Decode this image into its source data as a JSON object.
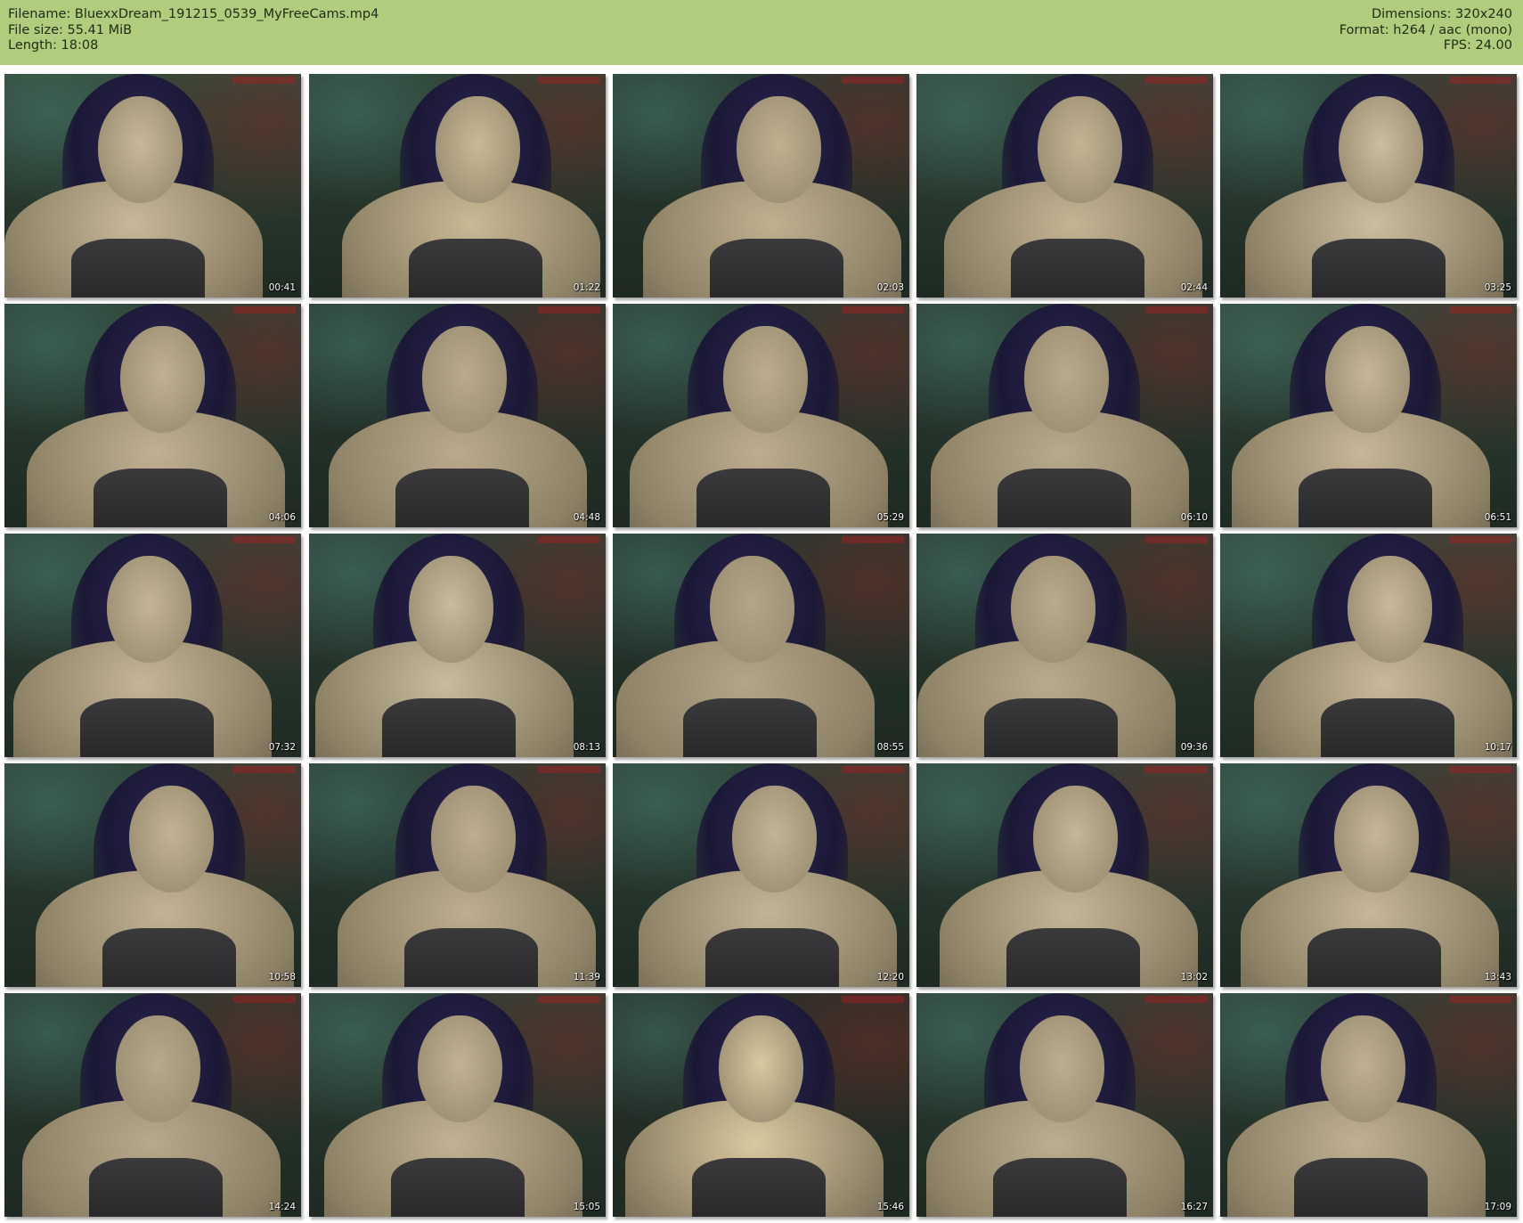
{
  "header": {
    "filename_line": "Filename: BluexxDream_191215_0539_MyFreeCams.mp4",
    "filesize_line": "File size: 55.41 MiB",
    "length_line": "Length: 18:08",
    "dimensions_line": "Dimensions: 320x240",
    "format_line": "Format: h264 / aac (mono)",
    "fps_line": "FPS: 24.00",
    "background_color": "#b0cd7e"
  },
  "thumbnails": [
    {
      "timestamp": "00:41"
    },
    {
      "timestamp": "01:22"
    },
    {
      "timestamp": "02:03"
    },
    {
      "timestamp": "02:44"
    },
    {
      "timestamp": "03:25"
    },
    {
      "timestamp": "04:06"
    },
    {
      "timestamp": "04:48"
    },
    {
      "timestamp": "05:29"
    },
    {
      "timestamp": "06:10"
    },
    {
      "timestamp": "06:51"
    },
    {
      "timestamp": "07:32"
    },
    {
      "timestamp": "08:13"
    },
    {
      "timestamp": "08:55"
    },
    {
      "timestamp": "09:36"
    },
    {
      "timestamp": "10:17"
    },
    {
      "timestamp": "10:58"
    },
    {
      "timestamp": "11:39"
    },
    {
      "timestamp": "12:20"
    },
    {
      "timestamp": "13:02"
    },
    {
      "timestamp": "13:43"
    },
    {
      "timestamp": "14:24"
    },
    {
      "timestamp": "15:05"
    },
    {
      "timestamp": "15:46"
    },
    {
      "timestamp": "16:27"
    },
    {
      "timestamp": "17:09"
    }
  ]
}
